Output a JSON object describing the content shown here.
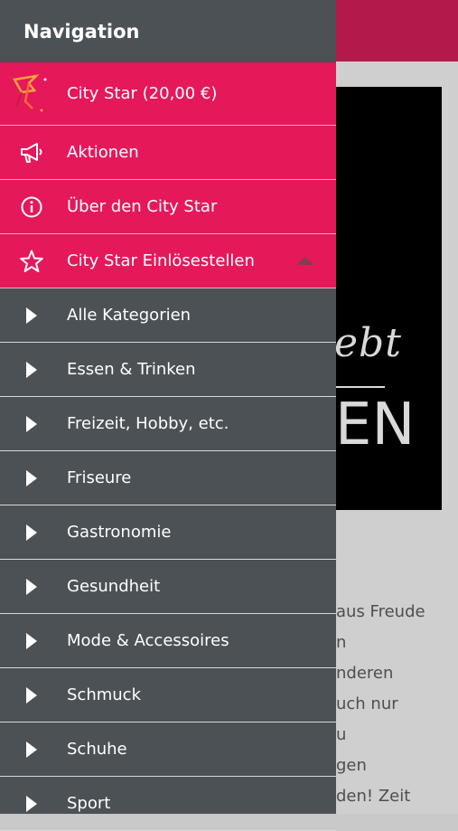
{
  "background": {
    "image_text": {
      "script": "ebt",
      "big": "EN"
    },
    "text_lines": [
      "aus Freude",
      "n",
      "nderen",
      "uch nur",
      "u",
      "gen",
      "den! Zeit"
    ]
  },
  "navigation": {
    "title": "Navigation",
    "main_items": [
      {
        "label": "City Star (20,00 €)",
        "icon": "city-star-logo-icon"
      },
      {
        "label": "Aktionen",
        "icon": "megaphone-icon"
      },
      {
        "label": "Über den City Star",
        "icon": "info-icon"
      },
      {
        "label": "City Star Einlösestellen",
        "icon": "star-outline-icon",
        "expanded": true
      }
    ],
    "categories": [
      "Alle Kategorien",
      "Essen & Trinken",
      "Freizeit, Hobby, etc.",
      "Friseure",
      "Gastronomie",
      "Gesundheit",
      "Mode & Accessoires",
      "Schmuck",
      "Schuhe",
      "Sport"
    ]
  },
  "colors": {
    "accent": "#e5185a",
    "drawer": "#4b5155",
    "topbar": "#b3194a"
  }
}
